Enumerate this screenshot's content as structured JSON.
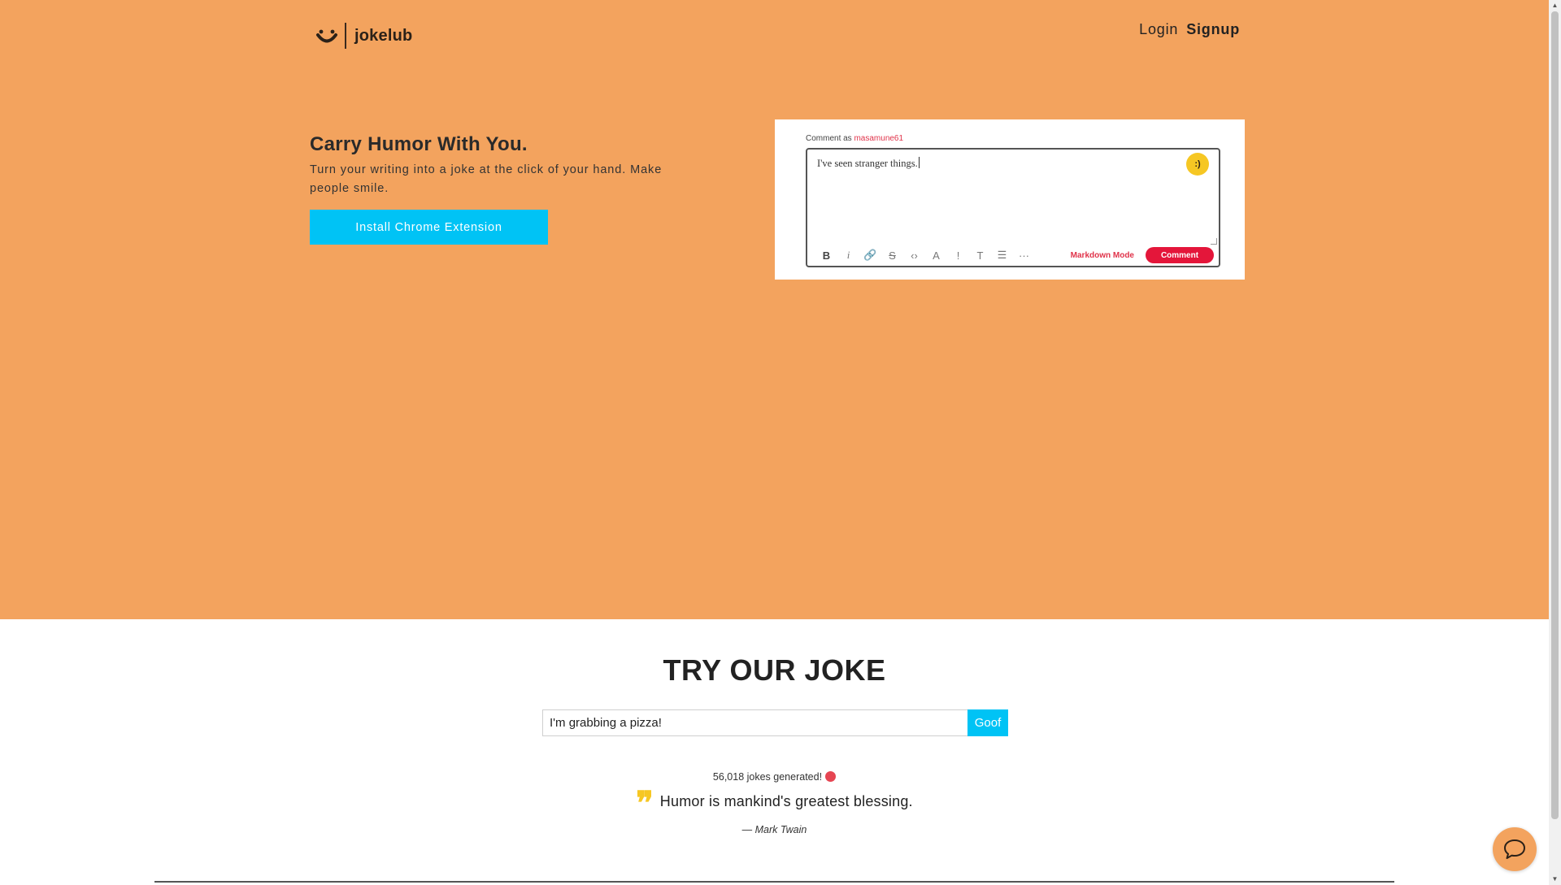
{
  "brand": {
    "name": "jokelub",
    "icon": "smile-logo-icon"
  },
  "nav": {
    "login": "Login",
    "signup": "Signup"
  },
  "hero": {
    "title": "Carry Humor With You.",
    "subtitle": "Turn your writing into a joke at the click of your hand. Make people smile.",
    "cta": "Install Chrome Extension"
  },
  "preview": {
    "comment_as": "Comment as",
    "username": "masamune61",
    "text": "I've seen stranger things.",
    "badge": ":)",
    "toolbar": {
      "bold": "B",
      "italic": "i",
      "link": "🔗",
      "strike": "S",
      "code": "‹›",
      "superscript": "A",
      "spoiler": "!",
      "heading": "T",
      "list": "☰",
      "more": "···"
    },
    "markdown_mode": "Markdown Mode",
    "comment_button": "Comment"
  },
  "try": {
    "title": "TRY OUR JOKE",
    "input_value": "I'm grabbing a pizza!",
    "button": "Goof"
  },
  "stats": {
    "count_text": "56,018 jokes generated!",
    "emoji": "star-struck-emoji"
  },
  "quote": {
    "text": "Humor is mankind's greatest blessing.",
    "author": "— Mark Twain"
  },
  "colors": {
    "hero_bg": "#f3a35e",
    "accent": "#00c3f5",
    "quote_icon": "#f6c723",
    "reddit_red": "#e4163a"
  },
  "chat": {
    "icon": "chat-bubble-icon"
  }
}
